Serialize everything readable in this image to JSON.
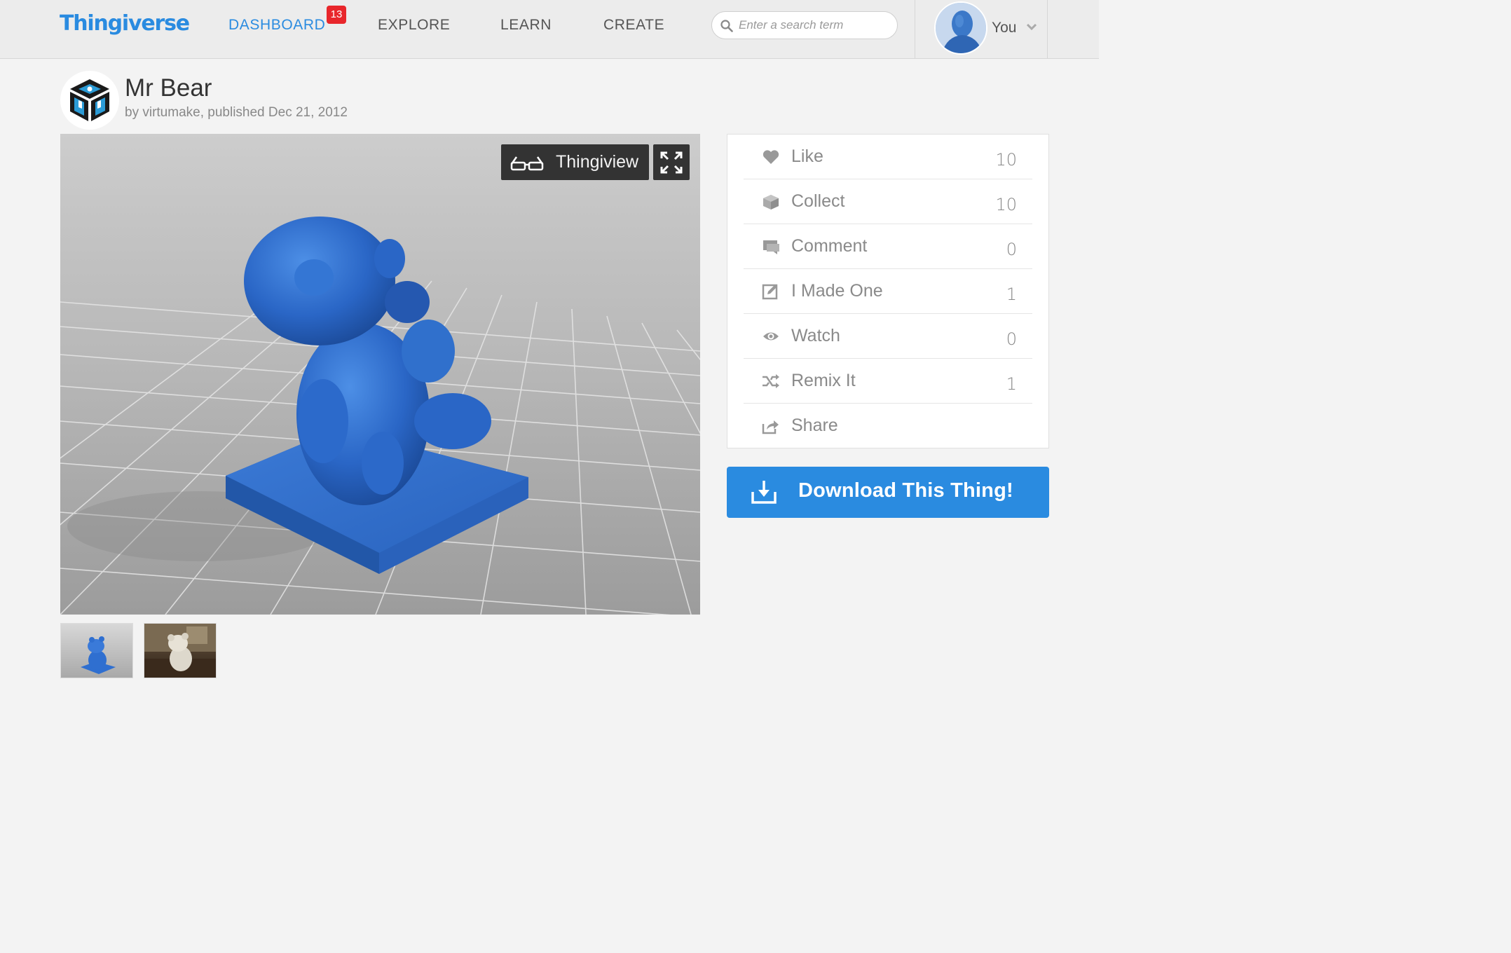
{
  "header": {
    "logo": "Thingiverse",
    "nav": [
      {
        "label": "DASHBOARD",
        "active": true,
        "badge": "13"
      },
      {
        "label": "EXPLORE",
        "active": false
      },
      {
        "label": "LEARN",
        "active": false
      },
      {
        "label": "CREATE",
        "active": false
      }
    ],
    "search": {
      "placeholder": "Enter a search term",
      "value": ""
    },
    "user": {
      "name": "You"
    }
  },
  "thing": {
    "title": "Mr Bear",
    "by_prefix": "by",
    "author": "virtumake",
    "published_label": ", published",
    "published_date": "Dec 21, 2012"
  },
  "viewer": {
    "thingiview_label": "Thingiview",
    "model_color": "#2f6fd0"
  },
  "thumbnails": [
    {
      "name": "blue-bear-render"
    },
    {
      "name": "printed-bear-photo"
    }
  ],
  "actions": [
    {
      "label": "Like",
      "count": "10",
      "icon": "heart-icon"
    },
    {
      "label": "Collect",
      "count": "10",
      "icon": "collect-box-icon"
    },
    {
      "label": "Comment",
      "count": "0",
      "icon": "comment-icon"
    },
    {
      "label": "I Made One",
      "count": "1",
      "icon": "edit-pencil-icon"
    },
    {
      "label": "Watch",
      "count": "0",
      "icon": "eye-icon"
    },
    {
      "label": "Remix It",
      "count": "1",
      "icon": "shuffle-icon"
    },
    {
      "label": "Share",
      "count": "",
      "icon": "share-icon"
    }
  ],
  "download": {
    "label": "Download This Thing!"
  },
  "colors": {
    "brand": "#2a8be0",
    "badge": "#e8262b",
    "dark_button": "#333333"
  }
}
